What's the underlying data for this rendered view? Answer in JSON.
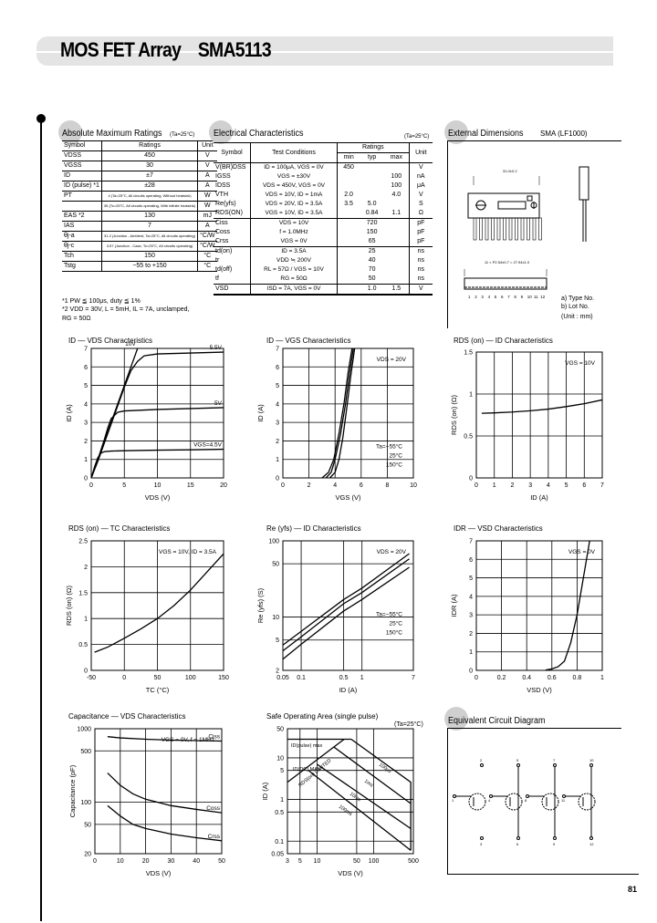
{
  "header": {
    "title": "MOS FET Array    SMA5113"
  },
  "absolute_max": {
    "title": "Absolute Maximum Ratings",
    "condition": "(Ta=25°C)",
    "columns": [
      "Symbol",
      "Ratings",
      "Unit"
    ],
    "rows": [
      {
        "symbol": "VDSS",
        "rating": "450",
        "unit": "V"
      },
      {
        "symbol": "VGSS",
        "rating": "30",
        "unit": "V"
      },
      {
        "symbol": "ID",
        "rating": "±7",
        "unit": "A"
      },
      {
        "symbol": "ID (pulse) *1",
        "rating": "±28",
        "unit": "A"
      },
      {
        "symbol": "PT",
        "rating": "4 (Ta=25°C, All circuits operating, Without heatsink)",
        "unit": "W"
      },
      {
        "symbol": "",
        "rating": "35 (Tc=25°C, All circuits operating, With infinite heatsink)",
        "unit": "W"
      },
      {
        "symbol": "EAS *2",
        "rating": "130",
        "unit": "mJ"
      },
      {
        "symbol": "IAS",
        "rating": "7",
        "unit": "A"
      },
      {
        "symbol": "θj-a",
        "rating": "31.2 (Junction - Ambient, Ta=25°C, All circuits operating)",
        "unit": "°C/W"
      },
      {
        "symbol": "θj-c",
        "rating": "3.57 (Junction - Case, Tc=25°C, All circuits operating)",
        "unit": "°C/W"
      },
      {
        "symbol": "Tch",
        "rating": "150",
        "unit": "°C"
      },
      {
        "symbol": "Tstg",
        "rating": "−55 to +150",
        "unit": "°C"
      }
    ],
    "notes": [
      "*1  PW ≦ 100μs,  duty ≦ 1%",
      "*2  VDD = 30V,  L = 5mH,  IL = 7A,  unclamped,",
      "     RG = 50Ω"
    ]
  },
  "electrical": {
    "title": "Electrical Characteristics",
    "condition": "(Ta=25°C)",
    "columns": {
      "symbol": "Symbol",
      "test": "Test Conditions",
      "ratings": "Ratings",
      "min": "min",
      "typ": "typ",
      "max": "max",
      "unit": "Unit"
    },
    "rows": [
      {
        "symbol": "V(BR)DSS",
        "test": "ID = 100μA,  VGS = 0V",
        "min": "450",
        "typ": "",
        "max": "",
        "unit": "V"
      },
      {
        "symbol": "IGSS",
        "test": "VGS = ±30V",
        "min": "",
        "typ": "",
        "max": "100",
        "unit": "nA"
      },
      {
        "symbol": "IDSS",
        "test": "VDS = 450V,  VGS = 0V",
        "min": "",
        "typ": "",
        "max": "100",
        "unit": "μA"
      },
      {
        "symbol": "VTH",
        "test": "VDS = 10V,  ID = 1mA",
        "min": "2.0",
        "typ": "",
        "max": "4.0",
        "unit": "V"
      },
      {
        "symbol": "Re(yfs)",
        "test": "VDS = 20V,  ID = 3.5A",
        "min": "3.5",
        "typ": "5.0",
        "max": "",
        "unit": "S"
      },
      {
        "symbol": "RDS(ON)",
        "test": "VGS = 10V,  ID = 3.5A",
        "min": "",
        "typ": "0.84",
        "max": "1.1",
        "unit": "Ω"
      },
      {
        "symbol": "Ciss",
        "test": "VDS = 10V",
        "min": "",
        "typ": "720",
        "max": "",
        "unit": "pF"
      },
      {
        "symbol": "Coss",
        "test": "f = 1.0MHz",
        "min": "",
        "typ": "150",
        "max": "",
        "unit": "pF"
      },
      {
        "symbol": "Crss",
        "test": "VGS = 0V",
        "min": "",
        "typ": "65",
        "max": "",
        "unit": "pF"
      },
      {
        "symbol": "td(on)",
        "test": "ID = 3.5A",
        "min": "",
        "typ": "25",
        "max": "",
        "unit": "ns"
      },
      {
        "symbol": "tr",
        "test": "VDD ≒ 200V",
        "min": "",
        "typ": "40",
        "max": "",
        "unit": "ns"
      },
      {
        "symbol": "td(off)",
        "test": "RL = 57Ω / VGS = 10V",
        "min": "",
        "typ": "70",
        "max": "",
        "unit": "ns"
      },
      {
        "symbol": "tf",
        "test": "RG = 50Ω",
        "min": "",
        "typ": "50",
        "max": "",
        "unit": "ns"
      },
      {
        "symbol": "VSD",
        "test": "ISD = 7A,  VGS = 0V",
        "min": "",
        "typ": "1.0",
        "max": "1.5",
        "unit": "V"
      }
    ]
  },
  "external_dimensions": {
    "title": "External Dimensions",
    "package": "SMA (LF1000)",
    "labels": {
      "width": "31.0±0.2",
      "pitch": "11 × P2.54±0.7 = 27.94±1.0",
      "side_width": "31.0±0.2",
      "type_no": "a) Type No.",
      "lot_no": "b) Lot No.",
      "unit": "(Unit : mm)",
      "pin_numbers": [
        "1",
        "2",
        "3",
        "4",
        "5",
        "6",
        "7",
        "8",
        "9",
        "10",
        "11",
        "12"
      ]
    }
  },
  "equivalent_circuit": {
    "title": "Equivalent Circuit Diagram",
    "transistors": [
      {
        "gate": "1",
        "drain": "2",
        "source": "3"
      },
      {
        "gate": "4",
        "drain": "5",
        "source": "6"
      },
      {
        "gate": "8",
        "drain": "7",
        "source": "9"
      },
      {
        "gate": "11",
        "drain": "10",
        "source": "12"
      }
    ]
  },
  "page_number": "81",
  "chart_data": [
    {
      "id": "id-vds",
      "type": "line",
      "title": "ID — VDS Characteristics",
      "xlabel": "VDS (V)",
      "ylabel": "ID (A)",
      "xlim": [
        0,
        20
      ],
      "ylim": [
        0,
        7
      ],
      "xticks": [
        0,
        5,
        10,
        15,
        20
      ],
      "yticks": [
        0,
        1,
        2,
        3,
        4,
        5,
        6,
        7
      ],
      "series": [
        {
          "name": "10V",
          "x": [
            0,
            2,
            4,
            6,
            7
          ],
          "y": [
            0,
            2,
            4,
            6,
            7
          ]
        },
        {
          "name": "5.5V",
          "x": [
            0,
            1,
            2,
            3,
            4,
            5,
            6,
            7,
            8,
            10,
            15,
            20
          ],
          "y": [
            0,
            0.9,
            1.9,
            2.9,
            3.9,
            4.9,
            5.8,
            6.3,
            6.6,
            6.7,
            6.75,
            6.8
          ]
        },
        {
          "name": "5V",
          "x": [
            0,
            1,
            2,
            2.5,
            3,
            4,
            5,
            10,
            15,
            20
          ],
          "y": [
            0,
            1.0,
            2.1,
            2.7,
            3.2,
            3.55,
            3.62,
            3.7,
            3.75,
            3.8
          ]
        },
        {
          "name": "VGS=4.5V",
          "x": [
            0,
            0.5,
            1,
            1.5,
            2,
            3,
            5,
            10,
            15,
            20
          ],
          "y": [
            0,
            0.6,
            1.1,
            1.35,
            1.42,
            1.45,
            1.47,
            1.5,
            1.52,
            1.55
          ]
        }
      ]
    },
    {
      "id": "id-vgs",
      "type": "line",
      "title": "ID — VGS Characteristics",
      "xlabel": "VGS (V)",
      "ylabel": "ID (A)",
      "xlim": [
        0,
        10
      ],
      "ylim": [
        0,
        7
      ],
      "xticks": [
        0,
        2,
        4,
        6,
        8,
        10
      ],
      "yticks": [
        0,
        1,
        2,
        3,
        4,
        5,
        6,
        7
      ],
      "annotation": "VDS = 20V",
      "series": [
        {
          "name": "Ta=−55°C",
          "x": [
            3.6,
            4.0,
            4.3,
            4.6,
            4.9,
            5.2,
            5.5
          ],
          "y": [
            0,
            0.3,
            1.0,
            2.2,
            3.8,
            5.5,
            7
          ]
        },
        {
          "name": "25°C",
          "x": [
            3.3,
            3.7,
            4.0,
            4.4,
            4.8,
            5.1,
            5.4
          ],
          "y": [
            0,
            0.3,
            1.0,
            2.3,
            4.0,
            5.6,
            7
          ]
        },
        {
          "name": "150°C",
          "x": [
            3.0,
            3.5,
            3.9,
            4.3,
            4.7,
            5.0,
            5.3
          ],
          "y": [
            0,
            0.3,
            1.0,
            2.4,
            4.1,
            5.7,
            7
          ]
        }
      ]
    },
    {
      "id": "rds-id",
      "type": "line",
      "title": "RDS (on) — ID Characteristics",
      "xlabel": "ID (A)",
      "ylabel": "RDS (on) (Ω)",
      "xlim": [
        0,
        7
      ],
      "ylim": [
        0,
        1.5
      ],
      "xticks": [
        0,
        1,
        2,
        3,
        4,
        5,
        6,
        7
      ],
      "yticks": [
        0,
        0.5,
        1.0,
        1.5
      ],
      "annotation": "VGS = 10V",
      "series": [
        {
          "name": "VGS=10V",
          "x": [
            0.3,
            1,
            2,
            3,
            4,
            5,
            6,
            7
          ],
          "y": [
            0.77,
            0.775,
            0.785,
            0.8,
            0.82,
            0.85,
            0.885,
            0.93
          ]
        }
      ]
    },
    {
      "id": "rds-tc",
      "type": "line",
      "title": "RDS (on) — TC Characteristics",
      "xlabel": "TC (°C)",
      "ylabel": "RDS (on) (Ω)",
      "xlim": [
        -50,
        150
      ],
      "ylim": [
        0,
        2.5
      ],
      "xticks": [
        -50,
        0,
        50,
        100,
        150
      ],
      "yticks": [
        0,
        0.5,
        1.0,
        1.5,
        2.0,
        2.5
      ],
      "annotation": "VGS = 10V, ID = 3.5A",
      "series": [
        {
          "name": "RDS(on)",
          "x": [
            -45,
            -25,
            0,
            25,
            50,
            75,
            100,
            125,
            150
          ],
          "y": [
            0.35,
            0.45,
            0.62,
            0.8,
            1.0,
            1.25,
            1.55,
            1.9,
            2.25
          ]
        }
      ]
    },
    {
      "id": "yfs-id",
      "type": "line",
      "title": "Re (yfs) — ID Characteristics",
      "xlabel": "ID (A)",
      "ylabel": "Re (yfs) (S)",
      "xscale": "log",
      "yscale": "log",
      "xlim": [
        0.05,
        7
      ],
      "ylim": [
        2,
        100
      ],
      "xticks": [
        0.05,
        0.1,
        0.5,
        1,
        7
      ],
      "yticks": [
        2,
        5,
        10,
        50,
        100
      ],
      "annotation": "VDS = 20V",
      "series": [
        {
          "name": "Ta=−55°C",
          "x": [
            0.05,
            0.1,
            0.5,
            1,
            6
          ],
          "y": [
            4.3,
            6.5,
            17,
            24,
            68
          ]
        },
        {
          "name": "25°C",
          "x": [
            0.05,
            0.1,
            0.5,
            1,
            6
          ],
          "y": [
            3.6,
            5.5,
            15,
            21,
            58
          ]
        },
        {
          "name": "150°C",
          "x": [
            0.05,
            0.1,
            0.5,
            1,
            6
          ],
          "y": [
            2.8,
            4.4,
            12,
            17,
            45
          ]
        }
      ]
    },
    {
      "id": "idr-vsd",
      "type": "line",
      "title": "IDR — VSD Characteristics",
      "xlabel": "VSD (V)",
      "ylabel": "IDR (A)",
      "xlim": [
        0,
        1.0
      ],
      "ylim": [
        0,
        7
      ],
      "xticks": [
        0,
        0.2,
        0.4,
        0.6,
        0.8,
        1.0
      ],
      "yticks": [
        0,
        1,
        2,
        3,
        4,
        5,
        6,
        7
      ],
      "annotation": "VGS = 0V",
      "series": [
        {
          "name": "IDR",
          "x": [
            0.55,
            0.6,
            0.65,
            0.7,
            0.75,
            0.8,
            0.85,
            0.9
          ],
          "y": [
            0.02,
            0.08,
            0.2,
            0.5,
            1.5,
            3.0,
            5.0,
            7.0
          ]
        }
      ]
    },
    {
      "id": "cap-vds",
      "type": "line",
      "title": "Capacitance — VDS Characteristics",
      "xlabel": "VDS (V)",
      "ylabel": "Capacitance (pF)",
      "yscale": "log",
      "xlim": [
        0,
        50
      ],
      "ylim": [
        20,
        1000
      ],
      "xticks": [
        0,
        10,
        20,
        30,
        40,
        50
      ],
      "yticks": [
        20,
        50,
        100,
        500,
        1000
      ],
      "annotation": "VGS = 0V, f = 1MHz",
      "series": [
        {
          "name": "Ciss",
          "x": [
            5,
            10,
            20,
            30,
            40,
            50
          ],
          "y": [
            780,
            750,
            720,
            700,
            690,
            680
          ]
        },
        {
          "name": "Coss",
          "x": [
            5,
            10,
            15,
            20,
            30,
            40,
            50
          ],
          "y": [
            250,
            170,
            130,
            110,
            90,
            80,
            72
          ]
        },
        {
          "name": "Crss",
          "x": [
            5,
            10,
            15,
            20,
            30,
            40,
            50
          ],
          "y": [
            90,
            65,
            50,
            44,
            37,
            33,
            30
          ]
        }
      ]
    },
    {
      "id": "soa",
      "type": "line",
      "title": "Safe Operating Area (single pulse)",
      "condition": "(Ta=25°C)",
      "xlabel": "VDS (V)",
      "ylabel": "ID (A)",
      "xscale": "log",
      "yscale": "log",
      "xlim": [
        3,
        500
      ],
      "ylim": [
        0.05,
        50
      ],
      "xticks": [
        3,
        5,
        10,
        50,
        100,
        500
      ],
      "yticks": [
        0.05,
        0.1,
        0.5,
        1,
        5,
        10,
        50
      ],
      "annotations": [
        "ID(pulse) max",
        "ID(DC) MAX",
        "RDS(on) LIMITED",
        "100μs",
        "1ms",
        "10ms",
        "100ms"
      ],
      "series": [
        {
          "name": "ID(pulse) max",
          "x": [
            3,
            40
          ],
          "y": [
            28,
            28
          ]
        },
        {
          "name": "RDS(on) LIMITED",
          "x": [
            3,
            30
          ],
          "y": [
            2.6,
            28
          ]
        },
        {
          "name": "100μs",
          "x": [
            40,
            450,
            450
          ],
          "y": [
            28,
            2.6,
            0.06
          ]
        },
        {
          "name": "1ms",
          "x": [
            20,
            450
          ],
          "y": [
            18,
            0.8
          ]
        },
        {
          "name": "10ms",
          "x": [
            10,
            450
          ],
          "y": [
            7,
            0.2
          ]
        },
        {
          "name": "100ms",
          "x": [
            7,
            450
          ],
          "y": [
            5,
            0.06
          ]
        }
      ]
    }
  ]
}
